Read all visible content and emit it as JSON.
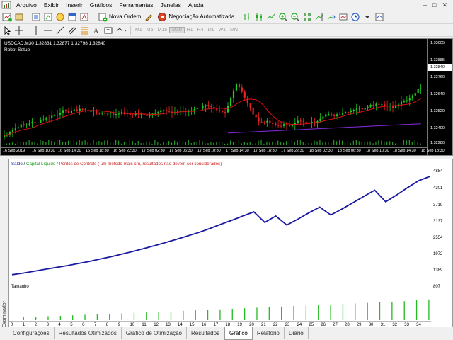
{
  "menubar": {
    "items": [
      "Arquivo",
      "Exibir",
      "Inserir",
      "Gráficos",
      "Ferramentas",
      "Janelas",
      "Ajuda"
    ],
    "window_controls": [
      "–",
      "□",
      "✕"
    ]
  },
  "toolbar": {
    "new_order_label": "Nova Ordem",
    "auto_trading_label": "Negociação Automatizada",
    "timeframes": [
      "M1",
      "M5",
      "M15",
      "M30",
      "H1",
      "H4",
      "D1",
      "W1",
      "MN"
    ],
    "active_timeframe": "M30"
  },
  "chart": {
    "symbol_line": "USDCAD,M30  1.32831 1.32877 1.32798 1.32840",
    "expert_label": "Robot Setup",
    "price_labels": [
      "1.33005",
      "1.32885",
      "1.32760",
      "1.32640",
      "1.32520",
      "1.32400",
      "1.32280"
    ],
    "current_price": "1.32840",
    "time_labels": [
      "16 Sep 2019",
      "16 Sep 10:30",
      "16 Sep 14:30",
      "16 Sep 18:30",
      "16 Sep 22:30",
      "17 Sep 02:30",
      "17 Sep 06:30",
      "17 Sep 10:30",
      "17 Sep 14:30",
      "17 Sep 18:30",
      "17 Sep 22:30",
      "18 Sep 02:30",
      "18 Sep 06:30",
      "18 Sep 10:30",
      "18 Sep 14:30",
      "18 Sep 18:30"
    ],
    "colors": {
      "bull": "#22cc22",
      "bear": "#ee2222",
      "ma": "#dd1111",
      "ma_slow": "#8a2be2",
      "bg": "#000000"
    }
  },
  "tester": {
    "side_tab": "Examinador",
    "legend": {
      "balance": "Saldo",
      "equity": "Capital Líquido",
      "control": "Pontos de Controle ( um método mais cru, resultados não devem ser considerados)"
    },
    "y_labels": [
      "4884",
      "4301",
      "3719",
      "3137",
      "2554",
      "1972",
      "1389",
      "807"
    ],
    "size_label": "Tamanho",
    "x_labels": [
      "0",
      "1",
      "2",
      "3",
      "4",
      "5",
      "6",
      "7",
      "8",
      "9",
      "10",
      "11",
      "12",
      "13",
      "14",
      "15",
      "16",
      "17",
      "18",
      "19",
      "20",
      "21",
      "22",
      "23",
      "24",
      "25",
      "26",
      "27",
      "28",
      "29",
      "30",
      "31",
      "32",
      "33",
      "34"
    ],
    "balance_series": [
      1000,
      1060,
      1130,
      1200,
      1270,
      1340,
      1420,
      1500,
      1590,
      1680,
      1780,
      1880,
      1990,
      2100,
      2220,
      2340,
      2470,
      2600,
      2750,
      2910,
      3060,
      3220,
      3380,
      2980,
      3220,
      2880,
      3100,
      3340,
      3560,
      3260,
      3480,
      3720,
      3960,
      4200,
      3760,
      4020,
      4300,
      4560,
      4720
    ],
    "size_series": [
      0.1,
      0.12,
      0.14,
      0.15,
      0.17,
      0.19,
      0.2,
      0.22,
      0.24,
      0.26,
      0.27,
      0.29,
      0.31,
      0.33,
      0.35,
      0.36,
      0.38,
      0.4,
      0.42,
      0.44,
      0.46,
      0.48,
      0.5,
      0.51,
      0.53,
      0.55,
      0.57,
      0.59,
      0.61,
      0.63,
      0.65,
      0.67,
      0.7,
      0.73
    ],
    "colors": {
      "balance": "#1a1aa0",
      "size": "#22bb22"
    }
  },
  "tabs": [
    "Configurações",
    "Resultados Otimizados",
    "Gráfico de Otimização",
    "Resultados",
    "Gráfico",
    "Relatório",
    "Diário"
  ],
  "active_tab": "Gráfico"
}
